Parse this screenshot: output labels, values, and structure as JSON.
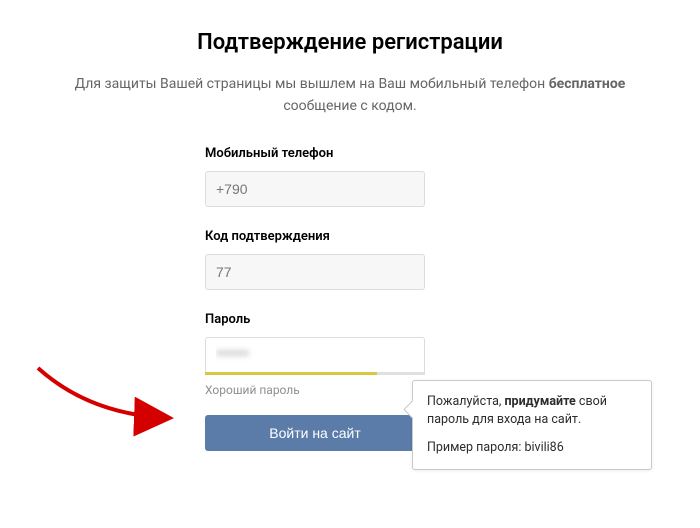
{
  "title": "Подтверждение регистрации",
  "subtitle_pre": "Для защиты Вашей страницы мы вышлем на Ваш мобильный телефон ",
  "subtitle_bold": "бесплатное",
  "subtitle_post": " сообщение с кодом.",
  "fields": {
    "phone": {
      "label": "Мобильный телефон",
      "value": "+790"
    },
    "code": {
      "label": "Код подтверждения",
      "value": "77"
    },
    "password": {
      "label": "Пароль",
      "value": "******",
      "strength": "Хороший пароль"
    }
  },
  "tooltip": {
    "pre": "Пожалуйста, ",
    "bold": "придумайте",
    "post": " свой пароль для входа на сайт.",
    "example_label": "Пример пароля: ",
    "example_value": "bivili86"
  },
  "submit": "Войти на сайт"
}
